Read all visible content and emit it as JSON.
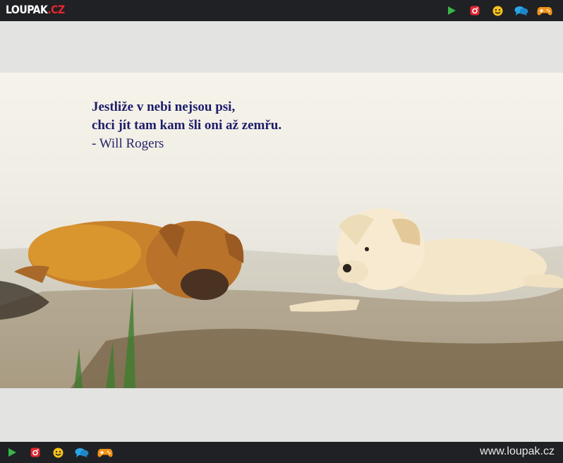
{
  "header": {
    "logo_main": "LOUPAK",
    "logo_tld": ".CZ",
    "icons": [
      "play-icon",
      "instagram-icon",
      "smiley-icon",
      "chat-icon",
      "gamepad-icon"
    ]
  },
  "photo": {
    "quote_line1": "Jestliže v nebi nejsou psi,",
    "quote_line2": "chci jít tam kam šli oni až zemřu.",
    "quote_author": "- Will Rogers"
  },
  "footer": {
    "icons": [
      "play-icon",
      "instagram-icon",
      "smiley-icon",
      "chat-icon",
      "gamepad-icon"
    ],
    "site_url": "www.loupak.cz"
  },
  "colors": {
    "bar": "#1f2124",
    "page_bg": "#e3e3e1",
    "play": "#39b54a",
    "instagram": "#e3262f",
    "smiley": "#f6c21a",
    "chat": "#2aa6e8",
    "gamepad": "#f39317",
    "quote_text": "#1d1d6b"
  }
}
